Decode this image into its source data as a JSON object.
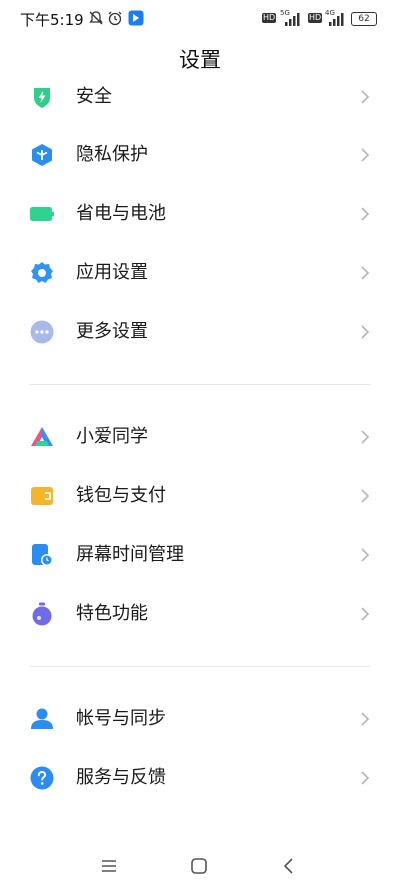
{
  "status_bar": {
    "time": "下午5:19",
    "battery": "62",
    "network_1": "5G",
    "network_2": "4G",
    "hd_1": "HD",
    "hd_2": "HD"
  },
  "header": {
    "title": "设置"
  },
  "groups": [
    {
      "items": [
        {
          "label": "安全",
          "icon": "shield-bolt-icon",
          "color": "#2ecf8a"
        },
        {
          "label": "隐私保护",
          "icon": "privacy-cube-icon",
          "color": "#2b8cf2"
        },
        {
          "label": "省电与电池",
          "icon": "battery-icon",
          "color": "#2fd28e"
        },
        {
          "label": "应用设置",
          "icon": "gear-icon",
          "color": "#2f95f3"
        },
        {
          "label": "更多设置",
          "icon": "more-dots-icon",
          "color": "#9aaee8"
        }
      ]
    },
    {
      "items": [
        {
          "label": "小爱同学",
          "icon": "xiaoai-icon",
          "color": "#6a5cf0"
        },
        {
          "label": "钱包与支付",
          "icon": "wallet-icon",
          "color": "#f5b52a"
        },
        {
          "label": "屏幕时间管理",
          "icon": "screen-time-icon",
          "color": "#2b8cf2"
        },
        {
          "label": "特色功能",
          "icon": "feature-bulb-icon",
          "color": "#6f6ce8"
        }
      ]
    },
    {
      "items": [
        {
          "label": "帐号与同步",
          "icon": "account-icon",
          "color": "#2b8cf2"
        },
        {
          "label": "服务与反馈",
          "icon": "help-icon",
          "color": "#2b8cf2"
        }
      ]
    }
  ],
  "navbar": {
    "icons": [
      "menu-icon",
      "home-icon",
      "back-icon"
    ]
  }
}
